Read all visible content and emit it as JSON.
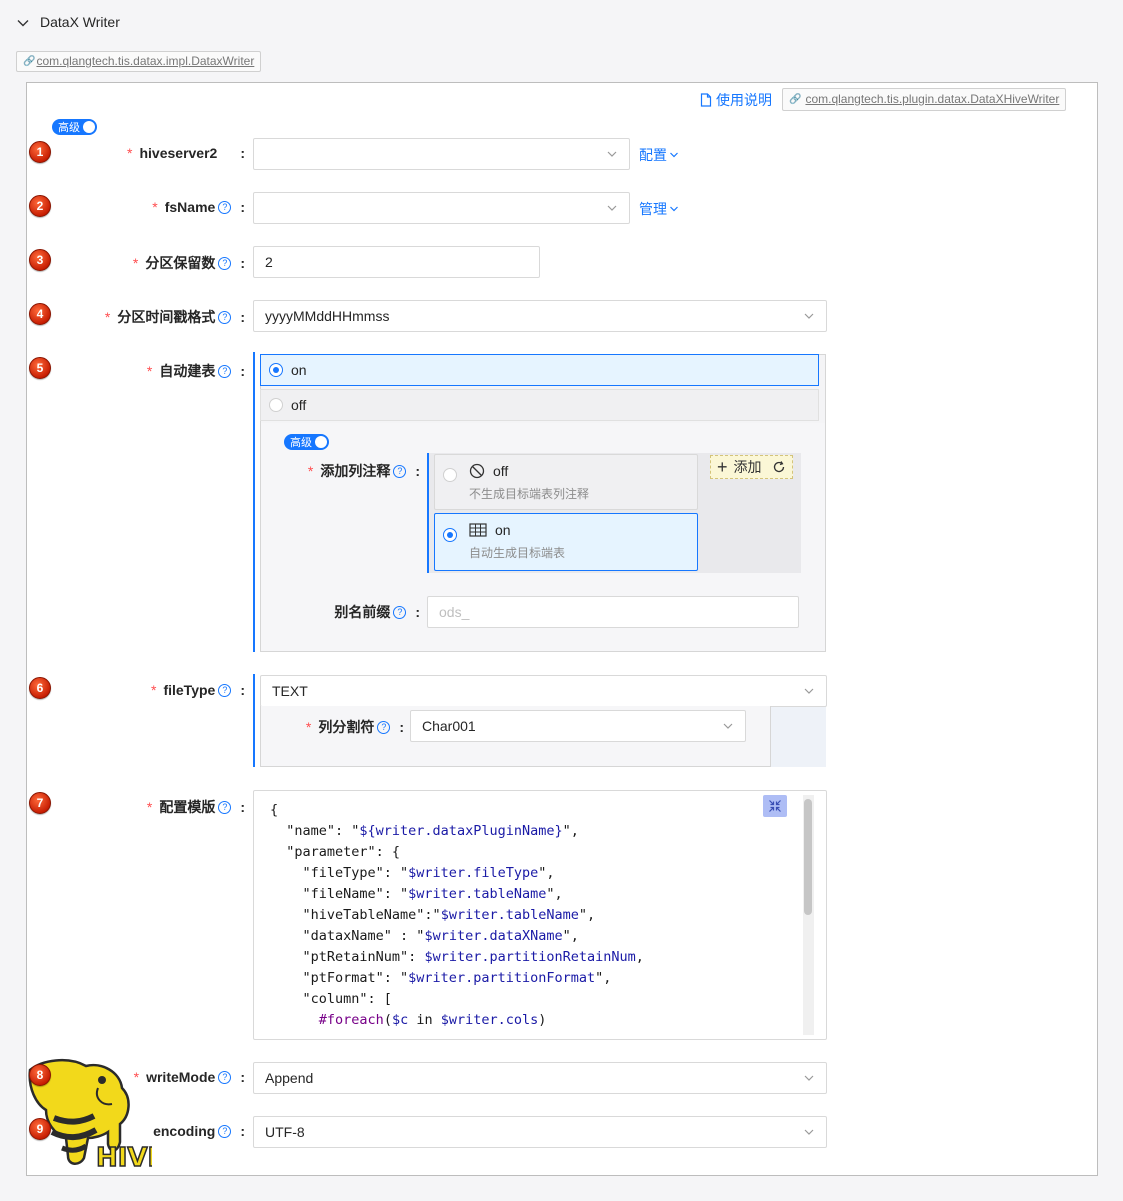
{
  "header": {
    "title": "DataX Writer",
    "impl_class": "com.qlangtech.tis.datax.impl.DataxWriter"
  },
  "panel": {
    "help_label": "使用说明",
    "plugin_class": "com.qlangtech.tis.plugin.datax.DataXHiveWriter",
    "advanced_toggle": "高级"
  },
  "fields": {
    "hiveserver2": {
      "num": "1",
      "label": "hiveserver2",
      "value": "",
      "side_link": "配置"
    },
    "fsName": {
      "num": "2",
      "label": "fsName",
      "value": "",
      "side_link": "管理"
    },
    "partitionRetain": {
      "num": "3",
      "label": "分区保留数",
      "value": "2"
    },
    "partitionFormat": {
      "num": "4",
      "label": "分区时间戳格式",
      "value": "yyyyMMddHHmmss"
    },
    "autoCreateTable": {
      "num": "5",
      "label": "自动建表",
      "options": [
        "on",
        "off"
      ],
      "selected": "on",
      "advanced_toggle": "高级",
      "addComment": {
        "label": "添加列注释",
        "off_title": "off",
        "off_desc": "不生成目标端表列注释",
        "on_title": "on",
        "on_desc": "自动生成目标端表",
        "selected": "on",
        "add_button": "添加"
      },
      "aliasPrefix": {
        "label": "别名前缀",
        "placeholder": "ods_"
      }
    },
    "fileType": {
      "num": "6",
      "label": "fileType",
      "value": "TEXT",
      "separator": {
        "label": "列分割符",
        "value": "Char001"
      }
    },
    "template": {
      "num": "7",
      "label": "配置模版",
      "lines": [
        "{",
        "  \"name\": \"${writer.dataxPluginName}\",",
        "  \"parameter\": {",
        "    \"fileType\": \"$writer.fileType\",",
        "    \"fileName\": \"$writer.tableName\",",
        "    \"hiveTableName\":\"$writer.tableName\",",
        "    \"dataxName\" : \"$writer.dataXName\",",
        "    \"ptRetainNum\": $writer.partitionRetainNum,",
        "    \"ptFormat\": \"$writer.partitionFormat\",",
        "    \"column\": [",
        "      #foreach($c in $writer.cols)"
      ]
    },
    "writeMode": {
      "num": "8",
      "label": "writeMode",
      "value": "Append"
    },
    "encoding": {
      "num": "9",
      "label": "encoding",
      "value": "UTF-8"
    }
  },
  "logo_text": "HIVE",
  "colors": {
    "accent": "#1677ff",
    "required": "#ff4d4f",
    "badge": "#d42a0a"
  }
}
